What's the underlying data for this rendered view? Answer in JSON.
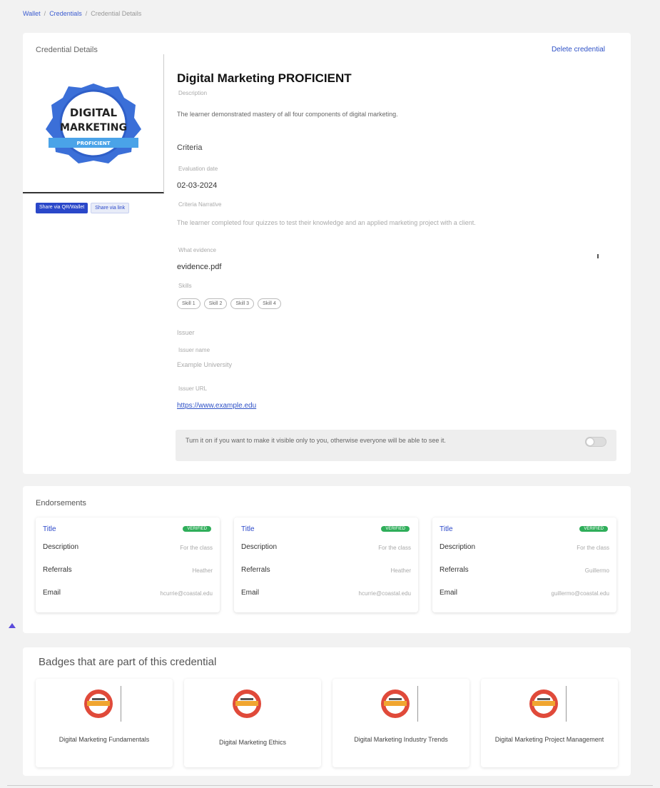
{
  "breadcrumb": {
    "items": [
      "Wallet",
      "Credentials",
      "Credential Details"
    ],
    "sep": "/"
  },
  "details": {
    "card_title": "Credential Details",
    "delete_label": "Delete credential",
    "badge_text": {
      "line1": "DIGITAL",
      "line2": "MARKETING",
      "ribbon": "PROFICIENT"
    },
    "share_primary": "Share via QR/Wallet",
    "share_secondary": "Share via link",
    "title": "Digital Marketing PROFICIENT",
    "description_label": "Description",
    "description": "The learner demonstrated mastery of all four components of digital marketing.",
    "criteria_heading": "Criteria",
    "eval_date_label": "Evaluation date",
    "eval_date": "02-03-2024",
    "criteria_narrative_label": "Criteria Narrative",
    "criteria_narrative": "The learner completed four quizzes to test their knowledge and an applied marketing project with a client.",
    "evidence_label": "What evidence",
    "evidence_file": "evidence.pdf",
    "skills_label": "Skills",
    "skills": [
      "Skill 1",
      "Skill 2",
      "Skill 3",
      "Skill 4"
    ],
    "issuer_heading": "Issuer",
    "issuer_name_label": "Issuer name",
    "issuer_name": "Example University",
    "issuer_url_label": "Issuer URL",
    "issuer_url": "https://www.example.edu",
    "toggle_text": "Turn it on if you want to make it visible only to you, otherwise everyone will be able to see it."
  },
  "endorsements": {
    "heading": "Endorsements",
    "cards": [
      {
        "title": "Title",
        "status": "VERIFIED",
        "description_label": "Description",
        "description": "For the class",
        "referrals_label": "Referrals",
        "referrals": "Heather",
        "email_label": "Email",
        "email": "hcurrie@coastal.edu"
      },
      {
        "title": "Title",
        "status": "VERIFIED",
        "description_label": "Description",
        "description": "For the class",
        "referrals_label": "Referrals",
        "referrals": "Heather",
        "email_label": "Email",
        "email": "hcurrie@coastal.edu"
      },
      {
        "title": "Title",
        "status": "VERIFIED",
        "description_label": "Description",
        "description": "For the class",
        "referrals_label": "Referrals",
        "referrals": "Guillermo",
        "email_label": "Email",
        "email": "guillermo@coastal.edu"
      }
    ]
  },
  "badges": {
    "heading": "Badges that are part of this credential",
    "items": [
      {
        "name": "Digital Marketing Fundamentals"
      },
      {
        "name": "Digital Marketing Ethics"
      },
      {
        "name": "Digital Marketing Industry Trends"
      },
      {
        "name": "Digital Marketing Project Management"
      }
    ]
  },
  "colors": {
    "accent": "#2a47c9",
    "badge_blue": "#3b6fd8",
    "verified": "#2fae5a",
    "mini_badge_red": "#e04a3a",
    "mini_badge_gold": "#f0a530"
  }
}
